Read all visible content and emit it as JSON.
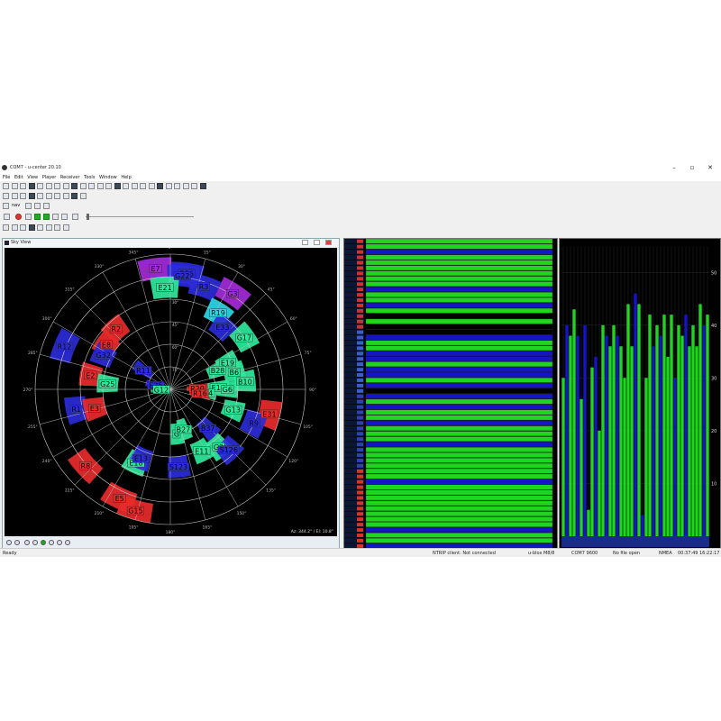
{
  "window": {
    "title": "COM7 - u-center 20.10",
    "controls": [
      "–",
      "▫",
      "✕"
    ]
  },
  "menu": [
    "File",
    "Edit",
    "View",
    "Player",
    "Receiver",
    "Tools",
    "Window",
    "Help"
  ],
  "toolbar": {
    "nav_value": "nav"
  },
  "skyview": {
    "title": "Sky View",
    "readout": "Az: 344.2° / El: 10.8°",
    "elevation_labels": [
      "15°",
      "30°",
      "45°",
      "60°",
      "75°"
    ],
    "azimuth_labels": [
      "0°",
      "15°",
      "30°",
      "45°",
      "60°",
      "75°",
      "90°",
      "105°",
      "120°",
      "135°",
      "150°",
      "165°",
      "180°",
      "195°",
      "210°",
      "225°",
      "240°",
      "255°",
      "270°",
      "285°",
      "300°",
      "315°",
      "330°",
      "345°"
    ],
    "satellites": [
      {
        "id": "B36",
        "az": 8,
        "el": 12,
        "color": "#2b2bd8"
      },
      {
        "id": "E7",
        "az": 353,
        "el": 9,
        "color": "#a22bd8"
      },
      {
        "id": "G22",
        "az": 6,
        "el": 14,
        "color": "#2b2bd8"
      },
      {
        "id": "R3",
        "az": 18,
        "el": 18,
        "color": "#2b2bd8"
      },
      {
        "id": "G3",
        "az": 33,
        "el": 14,
        "color": "#a22bd8"
      },
      {
        "id": "E21",
        "az": 357,
        "el": 22,
        "color": "#2fe89a"
      },
      {
        "id": "R19",
        "az": 32,
        "el": 30,
        "color": "#2bd8e8"
      },
      {
        "id": "E33",
        "az": 40,
        "el": 36,
        "color": "#2b2bd8"
      },
      {
        "id": "G17",
        "az": 55,
        "el": 30,
        "color": "#2fe89a"
      },
      {
        "id": "R2",
        "az": 318,
        "el": 36,
        "color": "#e82b2b"
      },
      {
        "id": "E8",
        "az": 305,
        "el": 38,
        "color": "#e82b2b"
      },
      {
        "id": "R12",
        "az": 292,
        "el": 14,
        "color": "#2b2bd8"
      },
      {
        "id": "G32",
        "az": 297,
        "el": 40,
        "color": "#2b2bd8"
      },
      {
        "id": "E19",
        "az": 65,
        "el": 48,
        "color": "#2fe89a"
      },
      {
        "id": "B28",
        "az": 68,
        "el": 56,
        "color": "#2fe89a"
      },
      {
        "id": "B6",
        "az": 75,
        "el": 46,
        "color": "#2fe89a"
      },
      {
        "id": "R11",
        "az": 305,
        "el": 68,
        "color": "#2b2bd8"
      },
      {
        "id": "E2",
        "az": 280,
        "el": 36,
        "color": "#e82b2b"
      },
      {
        "id": "G25",
        "az": 275,
        "el": 48,
        "color": "#2fe89a"
      },
      {
        "id": "E25",
        "az": 285,
        "el": 80,
        "color": "#2b2bd8"
      },
      {
        "id": "G12",
        "az": 268,
        "el": 84,
        "color": "#2fe89a"
      },
      {
        "id": "R20",
        "az": 88,
        "el": 72,
        "color": "#e82b2b"
      },
      {
        "id": "E14",
        "az": 88,
        "el": 58,
        "color": "#2fe89a"
      },
      {
        "id": "G6",
        "az": 90,
        "el": 52,
        "color": "#2fe89a"
      },
      {
        "id": "B10",
        "az": 84,
        "el": 40,
        "color": "#2fe89a"
      },
      {
        "id": "E24",
        "az": 96,
        "el": 66,
        "color": "#2fe89a"
      },
      {
        "id": "R16",
        "az": 98,
        "el": 70,
        "color": "#e82b2b"
      },
      {
        "id": "R1",
        "az": 258,
        "el": 26,
        "color": "#2b2bd8"
      },
      {
        "id": "E3",
        "az": 256,
        "el": 38,
        "color": "#e82b2b"
      },
      {
        "id": "E31",
        "az": 104,
        "el": 22,
        "color": "#e82b2b"
      },
      {
        "id": "G13",
        "az": 108,
        "el": 46,
        "color": "#2fe89a"
      },
      {
        "id": "R9",
        "az": 112,
        "el": 30,
        "color": "#2b2bd8"
      },
      {
        "id": "B37",
        "az": 136,
        "el": 54,
        "color": "#2b2bd8"
      },
      {
        "id": "G",
        "az": 172,
        "el": 60,
        "color": "#2fe89a"
      },
      {
        "id": "B27",
        "az": 162,
        "el": 62,
        "color": "#2fe89a"
      },
      {
        "id": "G2",
        "az": 140,
        "el": 40,
        "color": "#2fe89a"
      },
      {
        "id": "S126",
        "az": 136,
        "el": 34,
        "color": "#2b2bd8"
      },
      {
        "id": "E11",
        "az": 153,
        "el": 44,
        "color": "#2fe89a"
      },
      {
        "id": "S123",
        "az": 174,
        "el": 38,
        "color": "#2b2bd8"
      },
      {
        "id": "E18",
        "az": 205,
        "el": 36,
        "color": "#2fe89a"
      },
      {
        "id": "E13",
        "az": 203,
        "el": 40,
        "color": "#2b2bd8"
      },
      {
        "id": "R8",
        "az": 228,
        "el": 14,
        "color": "#e82b2b"
      },
      {
        "id": "E5",
        "az": 205,
        "el": 10,
        "color": "#e82b2b"
      },
      {
        "id": "G15",
        "az": 196,
        "el": 6,
        "color": "#e82b2b"
      }
    ]
  },
  "channels": {
    "rows": [
      {
        "flag": "us",
        "state": "g"
      },
      {
        "flag": "us",
        "state": "g"
      },
      {
        "flag": "us",
        "state": "b"
      },
      {
        "flag": "us",
        "state": "g"
      },
      {
        "flag": "us",
        "state": "g"
      },
      {
        "flag": "us",
        "state": "g"
      },
      {
        "flag": "us",
        "state": "g"
      },
      {
        "flag": "us",
        "state": "g"
      },
      {
        "flag": "us",
        "state": "g"
      },
      {
        "flag": "us",
        "state": "b"
      },
      {
        "flag": "us",
        "state": "g"
      },
      {
        "flag": "us",
        "state": "g"
      },
      {
        "flag": "us",
        "state": "b"
      },
      {
        "flag": "us",
        "state": "g"
      },
      {
        "flag": "us",
        "state": "k"
      },
      {
        "flag": "us",
        "state": "g"
      },
      {
        "flag": "us",
        "state": "k"
      },
      {
        "flag": "ru",
        "state": "k"
      },
      {
        "flag": "ru",
        "state": "b"
      },
      {
        "flag": "ru",
        "state": "g"
      },
      {
        "flag": "ru",
        "state": "g"
      },
      {
        "flag": "ru",
        "state": "b"
      },
      {
        "flag": "ru",
        "state": "b"
      },
      {
        "flag": "ru",
        "state": "g"
      },
      {
        "flag": "ru",
        "state": "b"
      },
      {
        "flag": "ru",
        "state": "b"
      },
      {
        "flag": "ru",
        "state": "g"
      },
      {
        "flag": "ru",
        "state": "b"
      },
      {
        "flag": "ru",
        "state": "k"
      },
      {
        "flag": "eu",
        "state": "b"
      },
      {
        "flag": "eu",
        "state": "g"
      },
      {
        "flag": "eu",
        "state": "b"
      },
      {
        "flag": "eu",
        "state": "g"
      },
      {
        "flag": "eu",
        "state": "g"
      },
      {
        "flag": "eu",
        "state": "b"
      },
      {
        "flag": "eu",
        "state": "g"
      },
      {
        "flag": "eu",
        "state": "g"
      },
      {
        "flag": "eu",
        "state": "g"
      },
      {
        "flag": "eu",
        "state": "b"
      },
      {
        "flag": "eu",
        "state": "g"
      },
      {
        "flag": "eu",
        "state": "g"
      },
      {
        "flag": "eu",
        "state": "g"
      },
      {
        "flag": "eu",
        "state": "g"
      },
      {
        "flag": "cn",
        "state": "g"
      },
      {
        "flag": "cn",
        "state": "g"
      },
      {
        "flag": "cn",
        "state": "b"
      },
      {
        "flag": "cn",
        "state": "g"
      },
      {
        "flag": "cn",
        "state": "g"
      },
      {
        "flag": "cn",
        "state": "g"
      },
      {
        "flag": "cn",
        "state": "g"
      },
      {
        "flag": "cn",
        "state": "g"
      },
      {
        "flag": "cn",
        "state": "g"
      },
      {
        "flag": "cn",
        "state": "g"
      },
      {
        "flag": "cn",
        "state": "g"
      },
      {
        "flag": "cn",
        "state": "b"
      },
      {
        "flag": "cn",
        "state": "g"
      },
      {
        "flag": "cn",
        "state": "g"
      },
      {
        "flag": "cn",
        "state": "b"
      }
    ]
  },
  "signal_chart": {
    "y_ticks": [
      "50",
      "40",
      "30",
      "20",
      "10"
    ],
    "y_max": 55,
    "bars": [
      {
        "v": 30,
        "c": "g"
      },
      {
        "v": 40,
        "c": "b"
      },
      {
        "v": 38,
        "c": "g"
      },
      {
        "v": 43,
        "c": "g"
      },
      {
        "v": 38,
        "c": "b"
      },
      {
        "v": 26,
        "c": "g"
      },
      {
        "v": 40,
        "c": "b"
      },
      {
        "v": 5,
        "c": "g"
      },
      {
        "v": 32,
        "c": "g"
      },
      {
        "v": 34,
        "c": "b"
      },
      {
        "v": 20,
        "c": "g"
      },
      {
        "v": 40,
        "c": "g"
      },
      {
        "v": 38,
        "c": "b"
      },
      {
        "v": 36,
        "c": "g"
      },
      {
        "v": 40,
        "c": "g"
      },
      {
        "v": 38,
        "c": "b"
      },
      {
        "v": 36,
        "c": "g"
      },
      {
        "v": 30,
        "c": "g"
      },
      {
        "v": 44,
        "c": "g"
      },
      {
        "v": 36,
        "c": "g"
      },
      {
        "v": 46,
        "c": "b"
      },
      {
        "v": 44,
        "c": "g"
      },
      {
        "v": 4,
        "c": "b"
      },
      {
        "v": 30,
        "c": "g"
      },
      {
        "v": 42,
        "c": "g"
      },
      {
        "v": 36,
        "c": "b"
      },
      {
        "v": 40,
        "c": "g"
      },
      {
        "v": 38,
        "c": "b"
      },
      {
        "v": 42,
        "c": "g"
      },
      {
        "v": 34,
        "c": "g"
      },
      {
        "v": 42,
        "c": "g"
      },
      {
        "v": 30,
        "c": "b"
      },
      {
        "v": 40,
        "c": "g"
      },
      {
        "v": 38,
        "c": "g"
      },
      {
        "v": 42,
        "c": "b"
      },
      {
        "v": 36,
        "c": "g"
      },
      {
        "v": 40,
        "c": "g"
      },
      {
        "v": 36,
        "c": "g"
      },
      {
        "v": 44,
        "c": "g"
      },
      {
        "v": 40,
        "c": "b"
      },
      {
        "v": 42,
        "c": "g"
      }
    ]
  },
  "status": {
    "ready": "Ready",
    "ntrip": "NTRIP client: Not connected",
    "receiver": "u-blox M8/8",
    "port": "COM7 9600",
    "file": "No file open",
    "protocol": "NMEA",
    "elapsed": "00:37:49",
    "clock": "16:22:17"
  },
  "colors": {
    "green": "#1fd51f",
    "blue": "#1515c8",
    "bg": "#000000"
  }
}
